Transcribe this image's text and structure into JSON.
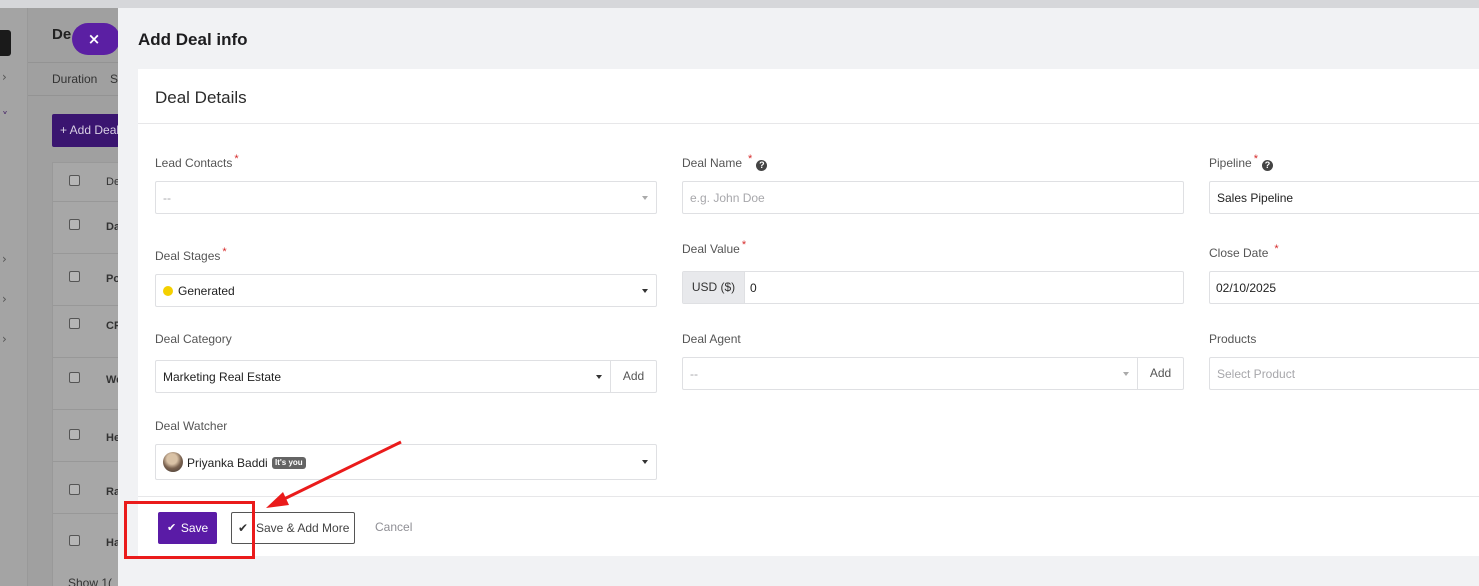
{
  "background": {
    "page_title": "De",
    "filter_duration": "Duration",
    "filter_next": "S",
    "add_button": "+ Add Deal",
    "table_header": "De",
    "rows": [
      "Da",
      "Po",
      "CF",
      "We",
      "He",
      "Ra",
      "Ha"
    ],
    "show_label": "Show  1("
  },
  "modal": {
    "close_icon": "×",
    "title": "Add Deal info",
    "section_title": "Deal Details",
    "fields": {
      "lead_contacts": {
        "label": "Lead Contacts",
        "value": "--"
      },
      "deal_name": {
        "label": "Deal Name",
        "placeholder": "e.g. John Doe"
      },
      "pipeline": {
        "label": "Pipeline",
        "value": "Sales Pipeline"
      },
      "deal_stages": {
        "label": "Deal Stages",
        "value": "Generated"
      },
      "deal_value": {
        "label": "Deal Value",
        "currency": "USD ($)",
        "value": "0"
      },
      "close_date": {
        "label": "Close Date",
        "value": "02/10/2025"
      },
      "deal_category": {
        "label": "Deal Category",
        "value": "Marketing Real Estate",
        "add_label": "Add"
      },
      "deal_agent": {
        "label": "Deal Agent",
        "value": "--",
        "add_label": "Add"
      },
      "products": {
        "label": "Products",
        "placeholder": "Select Product"
      },
      "deal_watcher": {
        "label": "Deal Watcher",
        "value": "Priyanka Baddi",
        "badge": "It's you"
      }
    },
    "required_mark": "*",
    "help_icon": "?",
    "buttons": {
      "save": "Save",
      "save_add_more": "Save & Add More",
      "cancel": "Cancel"
    }
  },
  "colors": {
    "accent": "#5a1ba6",
    "required": "#d62b2b",
    "annotation": "#ea1b1b",
    "stage_dot": "#f4d000"
  }
}
